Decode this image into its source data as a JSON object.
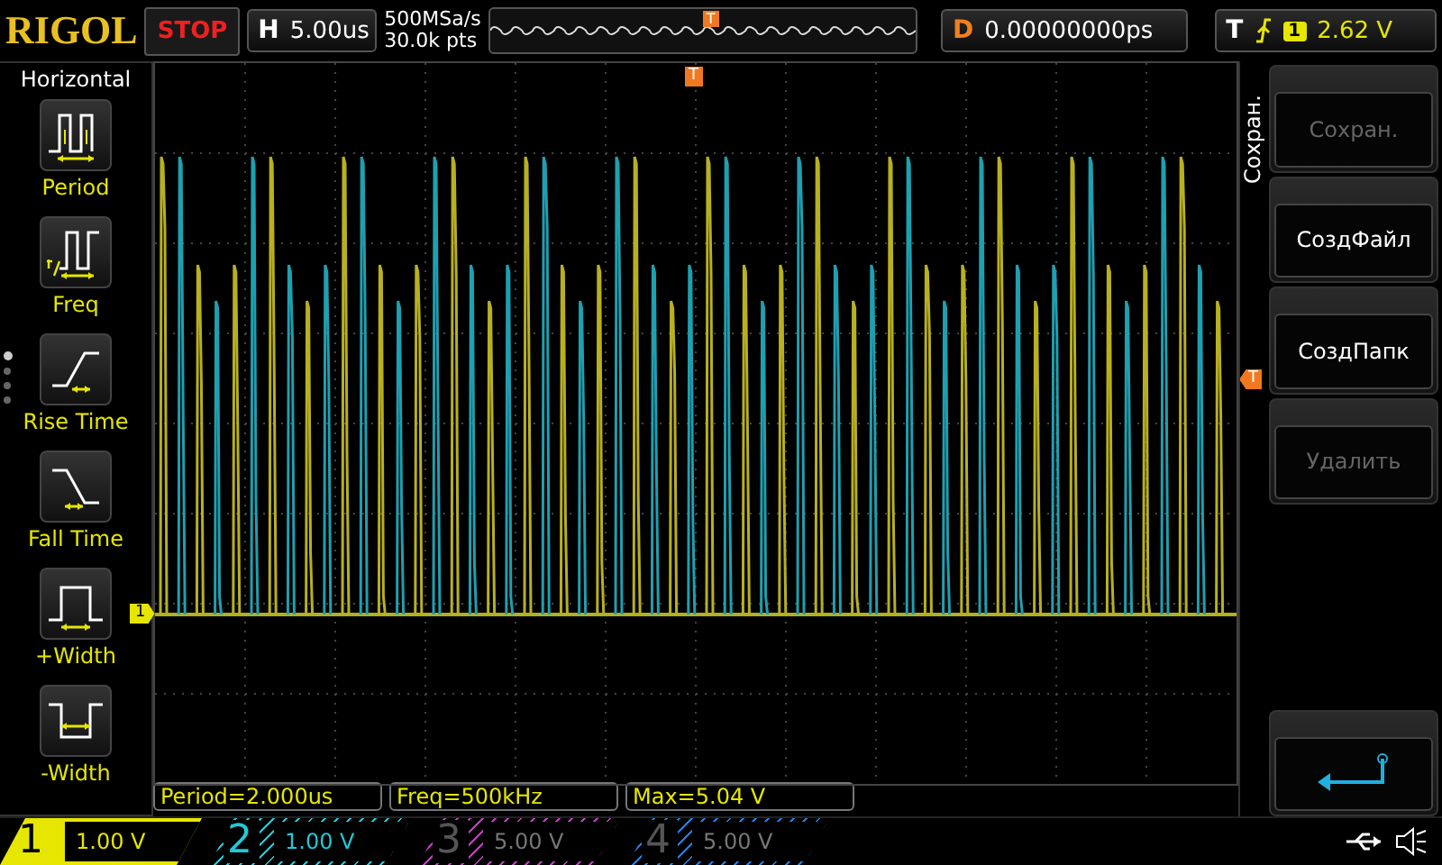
{
  "top_bar": {
    "logo": "RIGOL",
    "run_state": "STOP",
    "horizontal": {
      "label": "H",
      "value": "5.00us"
    },
    "sample_rate": "500MSa/s",
    "memory_depth": "30.0k pts",
    "trigger_mark": "T",
    "delay": {
      "label": "D",
      "value": "0.00000000ps"
    },
    "trigger": {
      "label": "T",
      "source": "1",
      "level": "2.62 V"
    }
  },
  "left_menu": {
    "title": "Horizontal",
    "items": [
      {
        "kind": "period",
        "label": "Period"
      },
      {
        "kind": "freq",
        "label": "Freq"
      },
      {
        "kind": "rise",
        "label": "Rise Time"
      },
      {
        "kind": "fall",
        "label": "Fall Time"
      },
      {
        "kind": "pwidth",
        "label": "+Width"
      },
      {
        "kind": "nwidth",
        "label": "-Width"
      }
    ],
    "page_dots": [
      {
        "selected": true
      },
      {
        "selected": false
      },
      {
        "selected": false
      },
      {
        "selected": false
      }
    ]
  },
  "screen": {
    "channel_marker": "1",
    "trigger_position_marker": "T",
    "trigger_level_marker": "T"
  },
  "right_menu": {
    "title": "Сохран.",
    "buttons": [
      {
        "kind": "text",
        "label": "Сохран.",
        "disabled": true
      },
      {
        "kind": "text",
        "label": "СоздФайл",
        "disabled": false
      },
      {
        "kind": "text",
        "label": "СоздПапк",
        "disabled": false
      },
      {
        "kind": "text",
        "label": "Удалить",
        "disabled": true
      },
      {
        "kind": "empty"
      },
      {
        "kind": "back"
      }
    ]
  },
  "measurements": [
    "Period=2.000us",
    "Freq=500kHz",
    "Max=5.04 V"
  ],
  "channels": [
    {
      "number": "1",
      "scale": "1.00 V",
      "on": true,
      "selected": true,
      "color": "#e6e600"
    },
    {
      "number": "2",
      "scale": "1.00 V",
      "on": true,
      "selected": false,
      "color": "#22c8d8"
    },
    {
      "number": "3",
      "scale": "5.00 V",
      "on": false,
      "selected": false,
      "color": "#c040c0"
    },
    {
      "number": "4",
      "scale": "5.00 V",
      "on": false,
      "selected": false,
      "color": "#2080e0"
    }
  ]
}
